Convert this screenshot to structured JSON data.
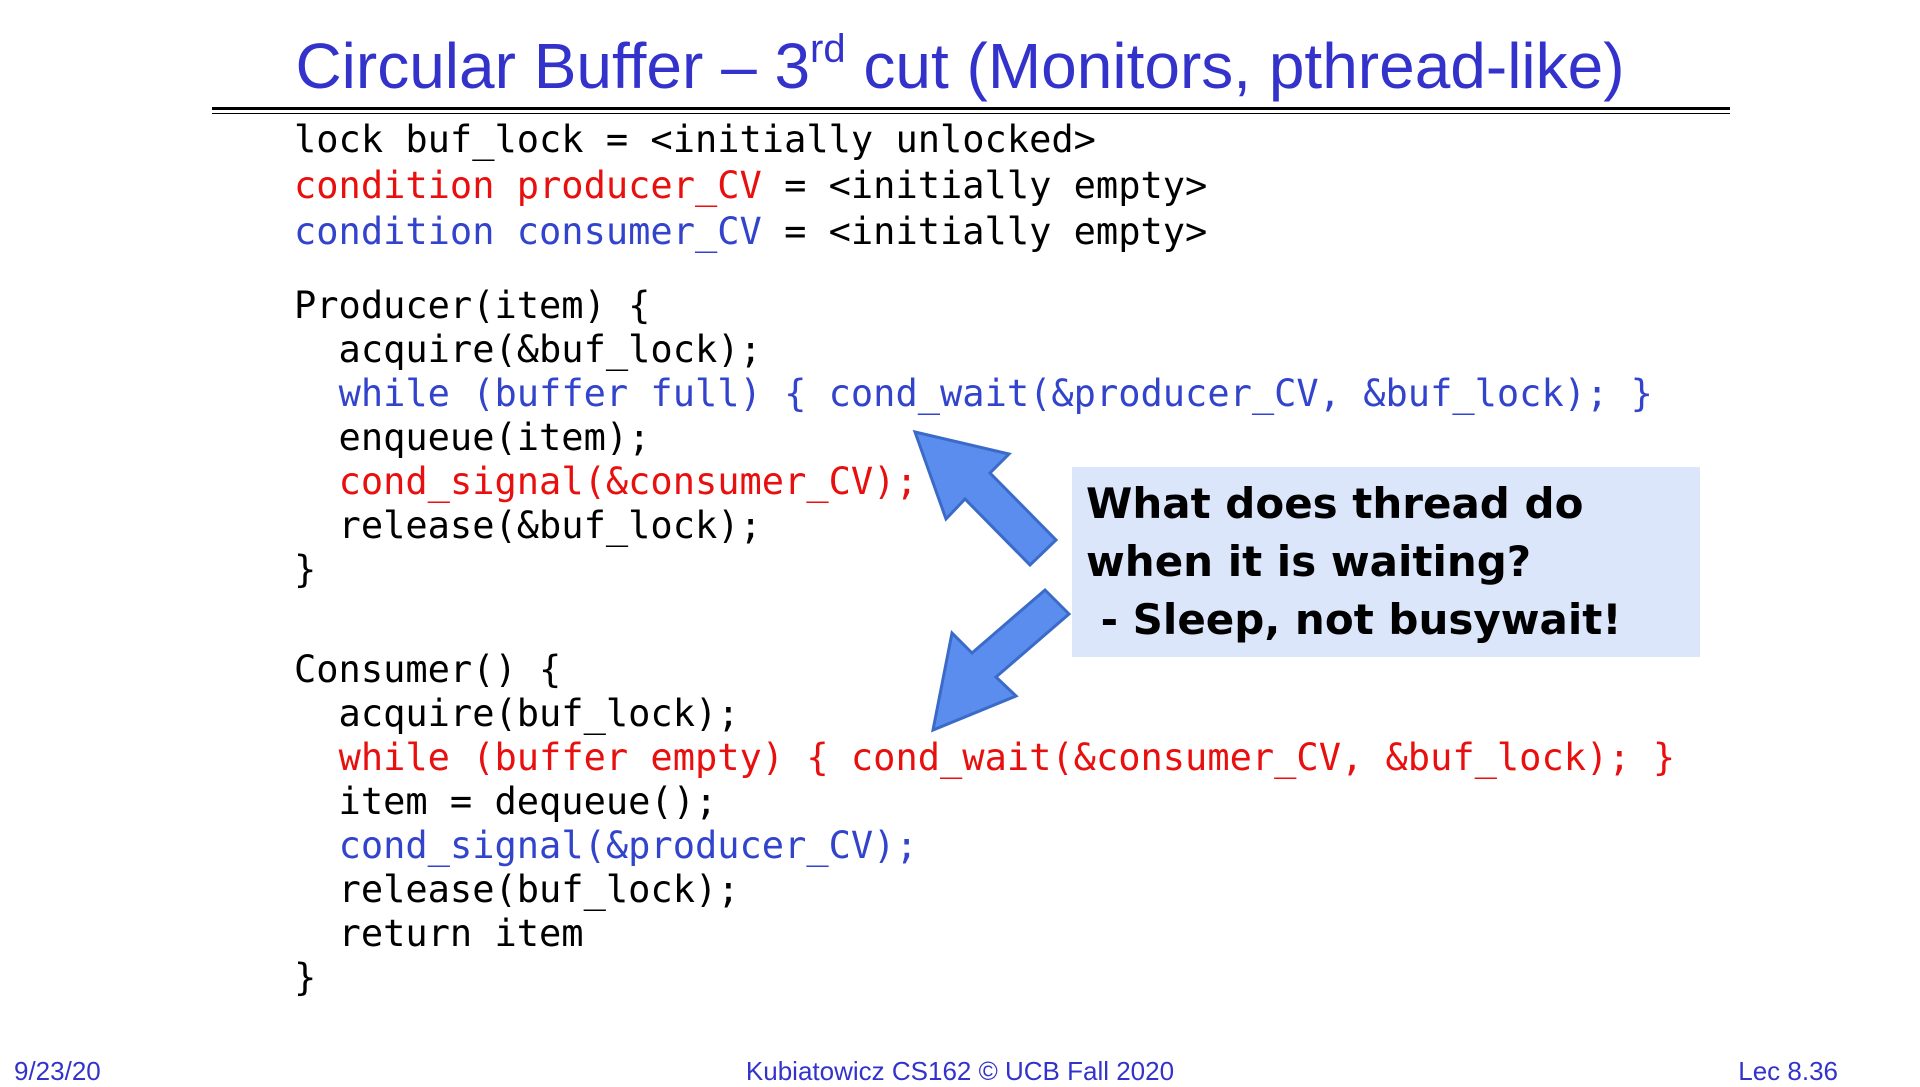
{
  "slide": {
    "title_main": "Circular Buffer – 3",
    "title_sup": "rd",
    "title_rest": " cut (Monitors, pthread-like)"
  },
  "declarations": {
    "lock": "lock buf_lock = <initially unlocked>",
    "producer_cv_decl": "condition producer_CV",
    "producer_cv_init": " = <initially empty>",
    "consumer_cv_decl": "condition consumer_CV",
    "consumer_cv_init": " = <initially empty>"
  },
  "producer": {
    "header": "Producer(item) {",
    "acquire": "  acquire(&buf_lock);",
    "while_indent": "  ",
    "while": "while (buffer full) { cond_wait(&producer_CV, &buf_lock); }",
    "enqueue": "  enqueue(item);",
    "signal_indent": "  ",
    "signal": "cond_signal(&consumer_CV);",
    "release": "  release(&buf_lock);",
    "close": "}"
  },
  "consumer": {
    "header": "Consumer() {",
    "acquire": "  acquire(buf_lock);",
    "while_indent": "  ",
    "while": "while (buffer empty) { cond_wait(&consumer_CV, &buf_lock); }",
    "dequeue": "  item = dequeue();",
    "signal_indent": "  ",
    "signal": "cond_signal(&producer_CV);",
    "release": "  release(buf_lock);",
    "return": "  return item",
    "close": "}"
  },
  "callout": {
    "line1": "What does thread do",
    "line2": "when it is waiting?",
    "line3": " - Sleep, not busywait!"
  },
  "footer": {
    "date": "9/23/20",
    "course": "Kubiatowicz CS162 © UCB Fall 2020",
    "lecture": "Lec 8.36"
  },
  "colors": {
    "title": "#3333cc",
    "code_red": "#e8100e",
    "code_blue": "#3344cc",
    "callout_bg": "#dbe6fb",
    "arrow_fill": "#5b8def",
    "arrow_stroke": "#3a6bc8"
  }
}
